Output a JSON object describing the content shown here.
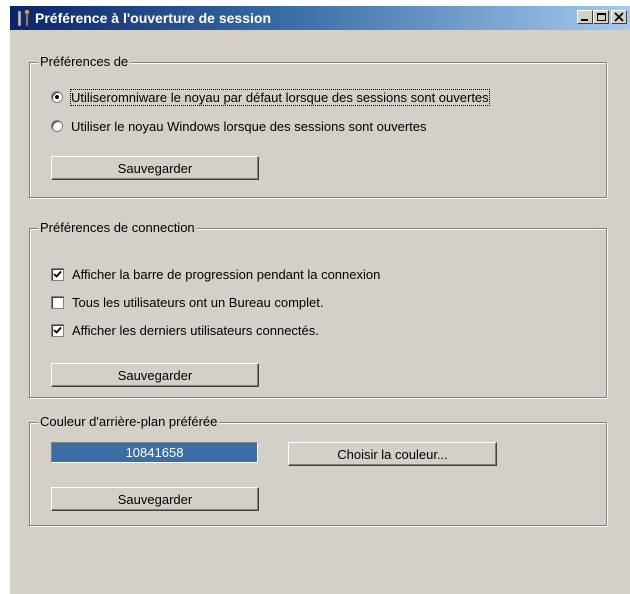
{
  "window": {
    "title": "Préférence à l'ouverture de session",
    "controls": [
      "minimize",
      "maximize",
      "close"
    ]
  },
  "kernel_group": {
    "label": "Préférences de",
    "options": [
      {
        "label": "Utiliseromniware le noyau par défaut lorsque des sessions sont ouvertes",
        "selected": true
      },
      {
        "label": "Utiliser le noyau Windows lorsque des sessions sont ouvertes",
        "selected": false
      }
    ],
    "save_label": "Sauvegarder"
  },
  "connection_group": {
    "label": "Préférences de connection",
    "options": [
      {
        "label": "Afficher la barre de progression pendant la connexion",
        "checked": true
      },
      {
        "label": "Tous les utilisateurs ont un Bureau complet.",
        "checked": false
      },
      {
        "label": "Afficher les derniers utilisateurs connectés.",
        "checked": true
      }
    ],
    "save_label": "Sauvegarder"
  },
  "color_group": {
    "label": "Couleur d'arrière-plan préférée",
    "color_value": "10841658",
    "color_hex": "#3a6ea5",
    "choose_label": "Choisir la couleur...",
    "save_label": "Sauvegarder"
  }
}
